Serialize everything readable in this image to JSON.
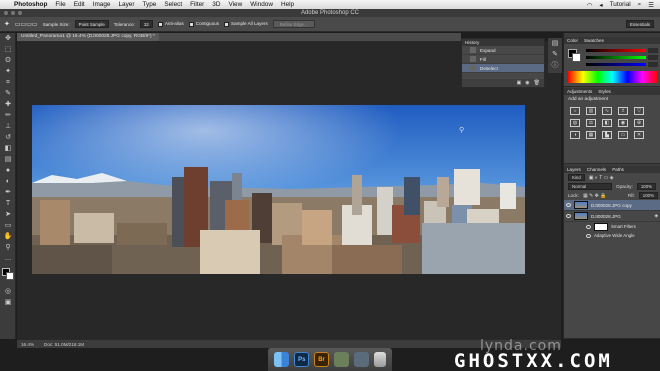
{
  "menubar": {
    "app": "Photoshop",
    "items": [
      "File",
      "Edit",
      "Image",
      "Layer",
      "Type",
      "Select",
      "Filter",
      "3D",
      "View",
      "Window",
      "Help"
    ],
    "user": "Tutorial"
  },
  "titlebar": {
    "title": "Adobe Photoshop CC"
  },
  "options": {
    "sample_size_label": "Sample Size:",
    "sample_size_value": "Point Sample",
    "tolerance_label": "Tolerance:",
    "tolerance_value": "32",
    "anti_alias": "Anti-alias",
    "contiguous": "Contiguous",
    "sample_all_layers": "Sample All Layers",
    "refine_edge": "Refine Edge...",
    "workspace": "Essentials"
  },
  "document": {
    "tab_label": "Untitled_Panorama1 @ 16.4% (DJI00028.JPG copy, RGB/8*) *"
  },
  "status": {
    "zoom": "16.4%",
    "doc_size": "Doc: 51.0M/218.1M"
  },
  "history": {
    "title": "History",
    "items": [
      "Expand",
      "Fill",
      "Deselect"
    ],
    "selected_index": 2
  },
  "color_panel": {
    "tabs": [
      "Color",
      "Swatches"
    ]
  },
  "adjustments": {
    "tabs": [
      "Adjustments",
      "Styles"
    ],
    "heading": "Add an adjustment"
  },
  "layers": {
    "tabs": [
      "Layers",
      "Channels",
      "Paths"
    ],
    "kind_label": "Kind",
    "blend_mode": "Normal",
    "opacity_label": "Opacity:",
    "opacity_value": "100%",
    "lock_label": "Lock:",
    "fill_label": "Fill:",
    "fill_value": "100%",
    "items": [
      {
        "name": "DJI00028.JPG copy",
        "selected": true
      },
      {
        "name": "DJI00028.JPG",
        "selected": false
      }
    ],
    "sub_items": [
      "Smart Filters",
      "Adaptive Wide Angle"
    ]
  },
  "dock": {
    "ps": "Ps",
    "br": "Br"
  },
  "watermarks": {
    "lynda": "lynda.com",
    "ghost": "GHOSTXX.COM"
  }
}
